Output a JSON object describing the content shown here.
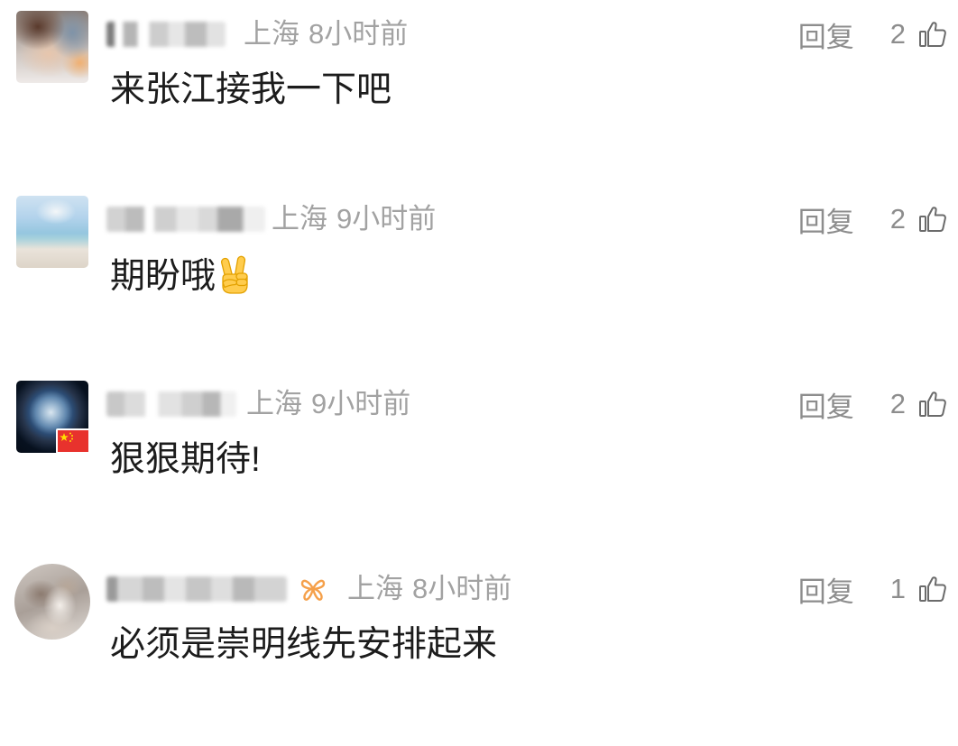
{
  "comments": [
    {
      "location": "上海",
      "time": "8小时前",
      "reply_label": "回复",
      "like_count": "2",
      "text": "来张江接我一下吧"
    },
    {
      "location": "上海",
      "time": "9小时前",
      "reply_label": "回复",
      "like_count": "2",
      "text": "期盼哦",
      "emoji": "victory-hand-icon"
    },
    {
      "location": "上海",
      "time": "9小时前",
      "reply_label": "回复",
      "like_count": "2",
      "text": "狠狠期待!",
      "avatar_badge": "china-flag-icon"
    },
    {
      "location": "上海",
      "time": "8小时前",
      "reply_label": "回复",
      "like_count": "1",
      "text": "必须是崇明线先安排起来",
      "user_badge": "butterfly-badge-icon"
    }
  ],
  "icons": {
    "like": "thumbs-up-icon"
  },
  "colors": {
    "comment_text": "#1c1c1c",
    "meta_text": "#a2a2a2",
    "action_text": "#8d8d8d",
    "like_icon": "#6b6b6b",
    "user_badge": "#f5a04a",
    "flag_red": "#e8322d",
    "emoji_yellow": "#ffcc4d"
  }
}
